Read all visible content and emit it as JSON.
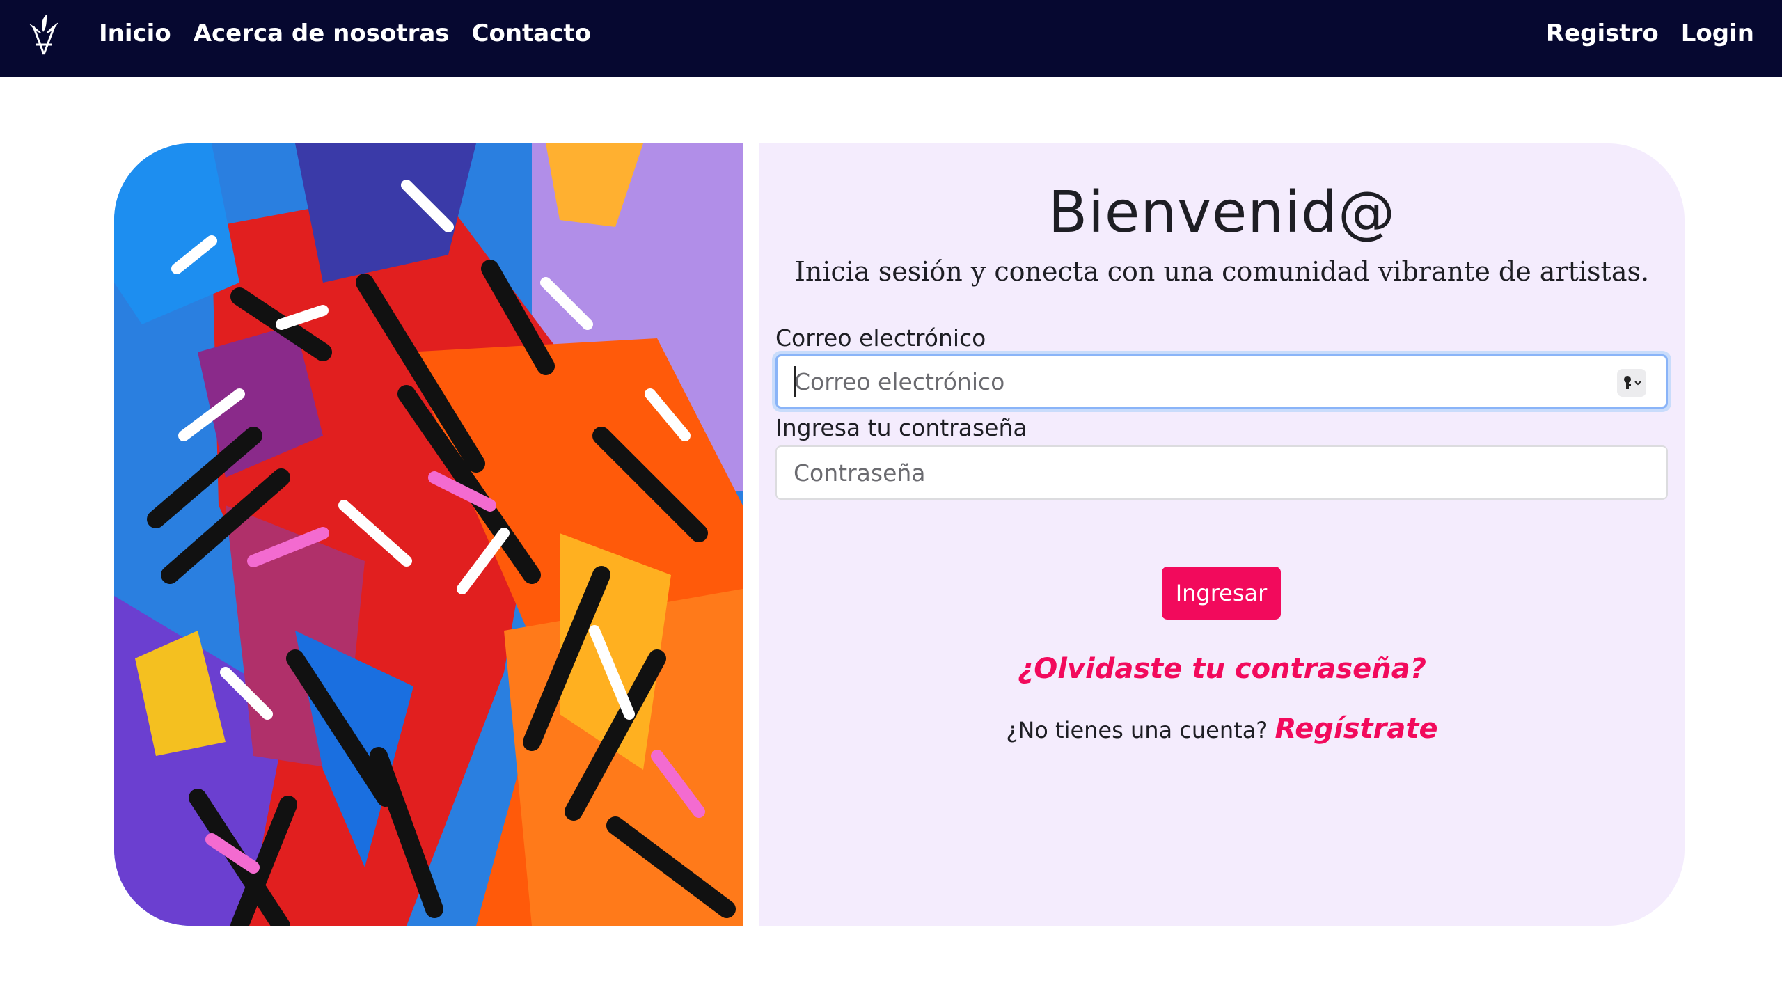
{
  "navbar": {
    "logo_icon": "feather-a-logo",
    "links_left": [
      "Inicio",
      "Acerca de nosotras",
      "Contacto"
    ],
    "links_right": [
      "Registro",
      "Login"
    ]
  },
  "colors": {
    "nav_bg": "#060830",
    "card_bg": "#f4ecfd",
    "accent": "#f20a5c"
  },
  "login": {
    "title": "Bienvenid@",
    "subtitle": "Inicia sesión y conecta con una comunidad vibrante de artistas.",
    "email_label": "Correo electrónico",
    "email_placeholder": "Correo electrónico",
    "email_value": "",
    "password_label": "Ingresa tu contraseña",
    "password_placeholder": "Contraseña",
    "password_value": "",
    "key_icon": "key-autofill-icon",
    "submit_label": "Ingresar",
    "forgot_label": "¿Olvidaste tu contraseña?",
    "no_account_text": "¿No tienes una cuenta?",
    "register_label": "Regístrate"
  }
}
